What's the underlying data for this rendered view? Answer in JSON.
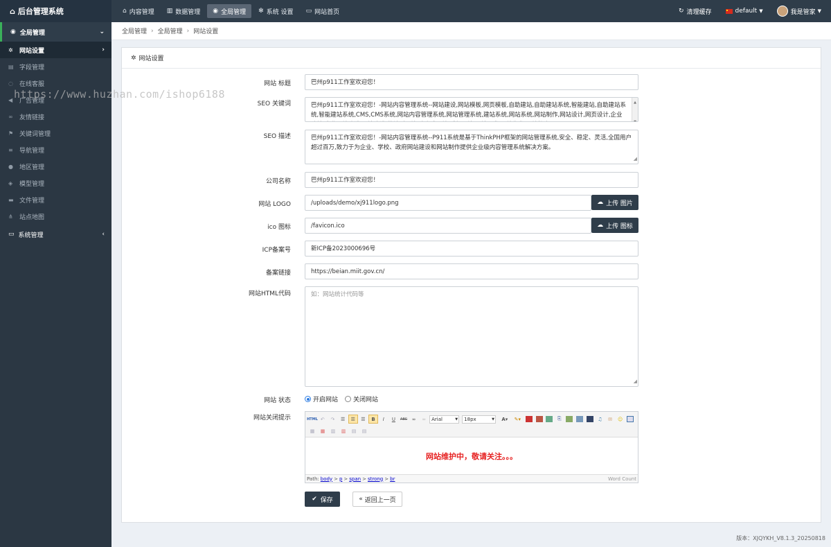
{
  "brand": {
    "title": "后台管理系统",
    "icon": "home-icon"
  },
  "topnav": [
    {
      "label": "内容管理",
      "icon": "home-icon",
      "active": false
    },
    {
      "label": "数据管理",
      "icon": "chart-icon",
      "active": false
    },
    {
      "label": "全局管理",
      "icon": "globe-icon",
      "active": true
    },
    {
      "label": "系统 设置",
      "icon": "gears-icon",
      "active": false
    },
    {
      "label": "网站首页",
      "icon": "monitor-icon",
      "active": false
    }
  ],
  "topright": {
    "clear_cache": "清理缓存",
    "language": "default",
    "user": "我是管家"
  },
  "sidebar": {
    "group": "全局管理",
    "items": [
      {
        "label": "网站设置",
        "icon": "gear-icon",
        "active": true
      },
      {
        "label": "字段管理",
        "icon": "list-icon"
      },
      {
        "label": "在线客服",
        "icon": "chat-icon"
      },
      {
        "label": "广告管理",
        "icon": "megaphone-icon"
      },
      {
        "label": "友情链接",
        "icon": "link-icon"
      },
      {
        "label": "关键词管理",
        "icon": "flag-icon"
      },
      {
        "label": "导航管理",
        "icon": "menu-icon"
      },
      {
        "label": "地区管理",
        "icon": "map-marker-icon"
      },
      {
        "label": "模型管理",
        "icon": "cubes-icon"
      },
      {
        "label": "文件管理",
        "icon": "folder-icon"
      },
      {
        "label": "站点地图",
        "icon": "sitemap-icon"
      }
    ],
    "group2": "系统管理"
  },
  "breadcrumb": [
    "全局管理",
    "全局管理",
    "网站设置"
  ],
  "panel": {
    "title": "网站设置"
  },
  "form": {
    "site_title": {
      "label": "网站 标题",
      "value": "巴州p911工作室欢迎您！"
    },
    "seo_keywords": {
      "label": "SEO 关键词",
      "value": "巴州p911工作室欢迎您！-网站内容管理系统--网站建设,网站模板,网页模板,自助建站,自助建站系统,智能建站,自助建站系统,智能建站系统,CMS,CMS系统,网站内容管理系统,网站管理系统,建站系统,网站系统,网站制作,网站设计,网页设计,企业建站,企业网站建设,网站建设,营销型网站,响应式网站,手机网站,网站开发,网站优化,网站推广"
    },
    "seo_desc": {
      "label": "SEO 描述",
      "value": "巴州p911工作室欢迎您！-网站内容管理系统--P911系统是基于ThinkPHP框架的网站管理系统,安全、稳定、灵活,全国用户超过百万,致力于为企业、学校、政府网站建设和网站制作提供企业级内容管理系统解决方案。"
    },
    "company": {
      "label": "公司名称",
      "value": "巴州p911工作室欢迎您！"
    },
    "logo": {
      "label": "网站 LOGO",
      "value": "/uploads/demo/xj911logo.png",
      "button": "上传 图片"
    },
    "ico": {
      "label": "ico 图标",
      "value": "/favicon.ico",
      "button": "上传 图标"
    },
    "icp": {
      "label": "ICP备案号",
      "value": "新ICP备2023000696号"
    },
    "icp_link": {
      "label": "备案链接",
      "value": "https://beian.miit.gov.cn/"
    },
    "html_code": {
      "label": "网站HTML代码",
      "placeholder": "如：网站统计代码等"
    },
    "status": {
      "label": "网站 状态",
      "options": [
        "开启网站",
        "关闭网站"
      ],
      "selected": "开启网站"
    },
    "close_tip": {
      "label": "网站关闭提示",
      "content": "网站维护中，敬请关注。。。",
      "font": "Arial",
      "size": "18px",
      "path_label": "Path:",
      "path": [
        "body",
        "p",
        "span",
        "strong",
        "br"
      ],
      "word_count": "Word Count"
    }
  },
  "actions": {
    "save": "保存",
    "back": "返回上一页"
  },
  "footer": {
    "version": "版本：XJQYKH_V8.1.3_20250818"
  },
  "watermark": "https://www.huzhan.com/ishop6188"
}
